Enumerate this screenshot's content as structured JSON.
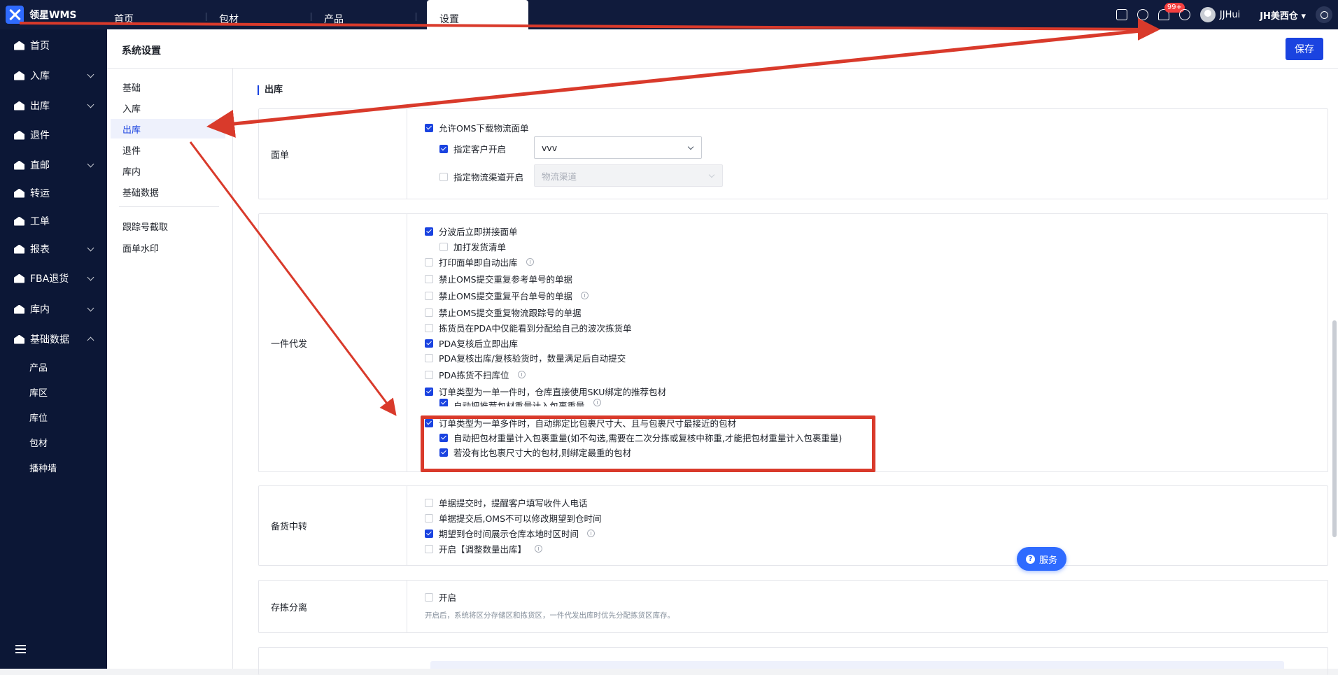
{
  "app": {
    "name": "领星WMS"
  },
  "tabs": [
    "首页",
    "包材",
    "产品",
    "设置"
  ],
  "topbar": {
    "badge": "99+",
    "username": "JJHui",
    "warehouse": "JH美西仓"
  },
  "sidebar": {
    "items": [
      "首页",
      "入库",
      "出库",
      "退件",
      "直邮",
      "转运",
      "工单",
      "报表",
      "FBA退货",
      "库内",
      "基础数据"
    ],
    "subitems": [
      "产品",
      "库区",
      "库位",
      "包材",
      "播种墙"
    ]
  },
  "header": {
    "title": "系统设置",
    "save": "保存"
  },
  "leftnav": [
    "基础",
    "入库",
    "出库",
    "退件",
    "库内",
    "基础数据",
    "跟踪号截取",
    "面单水印"
  ],
  "section_title": "出库",
  "panels": {
    "miandan": {
      "label": "面单",
      "rows": [
        "允许OMS下载物流面单",
        "指定客户开启",
        "指定物流渠道开启"
      ],
      "select1": "vvv",
      "select2": "物流渠道"
    },
    "yijian": {
      "label": "一件代发",
      "rows": [
        "分波后立即拼接面单",
        "加打发货清单",
        "打印面单即自动出库",
        "禁止OMS提交重复参考单号的单据",
        "禁止OMS提交重复平台单号的单据",
        "禁止OMS提交重复物流跟踪号的单据",
        "拣货员在PDA中仅能看到分配给自己的波次拣货单",
        "PDA复核后立即出库",
        "PDA复核出库/复核验货时，数量满足后自动提交",
        "PDA拣货不扫库位",
        "订单类型为一单一件时，仓库直接使用SKU绑定的推荐包材",
        "自动把推荐包材重量计入包裹重量",
        "订单类型为一单多件时，自动绑定比包裹尺寸大、且与包裹尺寸最接近的包材",
        "自动把包材重量计入包裹重量(如不勾选,需要在二次分拣或复核中称重,才能把包材重量计入包裹重量)",
        "若没有比包裹尺寸大的包材,则绑定最重的包材"
      ]
    },
    "beihuo": {
      "label": "备货中转",
      "rows": [
        "单据提交时，提醒客户填写收件人电话",
        "单据提交后,OMS不可以修改期望到仓时间",
        "期望到仓时间展示仓库本地时区时间",
        "开启【调整数量出库】"
      ]
    },
    "cunjian": {
      "label": "存拣分离",
      "rows": [
        "开启"
      ],
      "hint": "开启后，系统将区分存储区和拣货区，一件代发出库时优先分配拣货区库存。"
    }
  },
  "service": "服务",
  "accent": "#1a43e0",
  "annotation_color": "#d93a2b"
}
